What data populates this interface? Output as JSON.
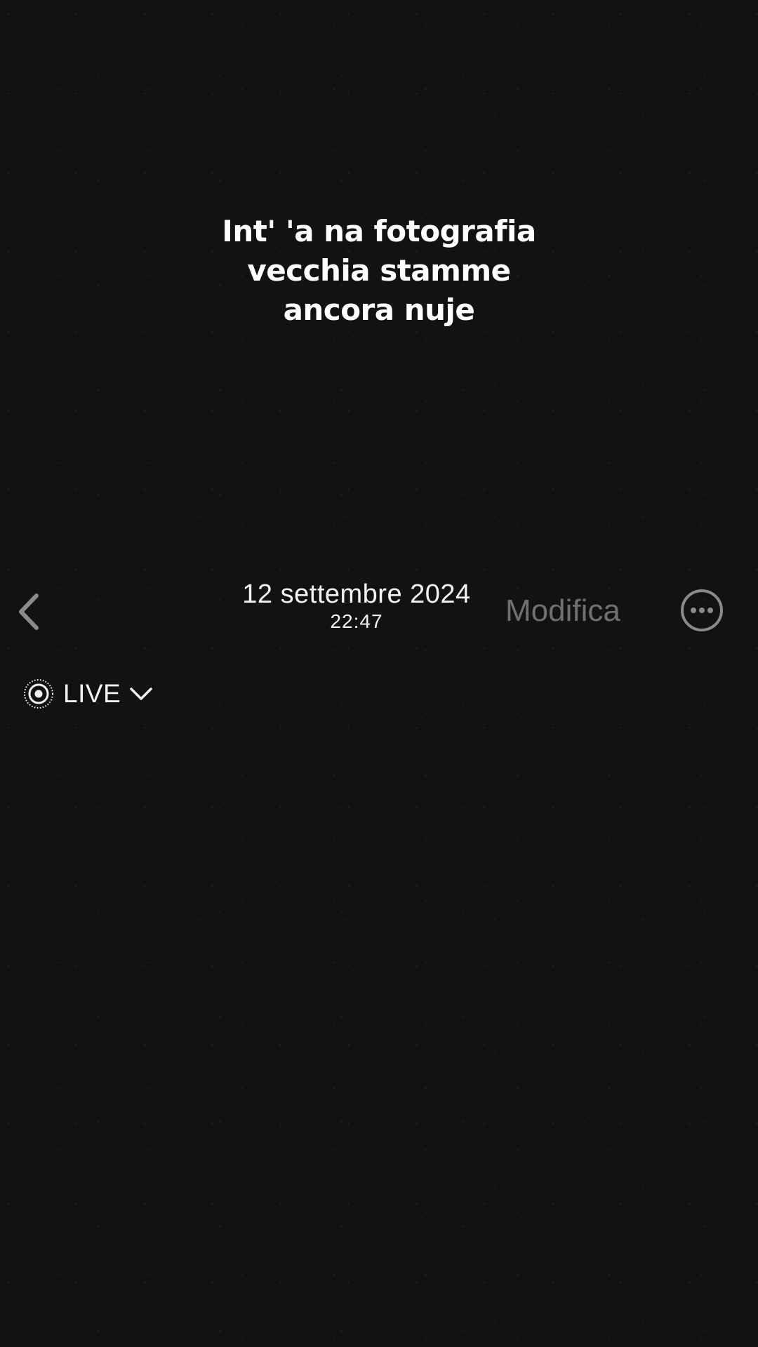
{
  "story": {
    "caption": "Int' 'a na fotografia\nvecchia stamme\nancora nuje"
  },
  "header": {
    "date": "12 settembre 2024",
    "time": "22:47",
    "edit_label": "Modifica",
    "back_icon": "chevron-left-icon",
    "more_icon": "ellipsis-circle-icon"
  },
  "live": {
    "label": "LIVE",
    "icon": "live-photo-icon",
    "dropdown_icon": "chevron-down-icon"
  },
  "colors": {
    "background": "#121212",
    "text": "#ffffff",
    "muted": "#707070"
  }
}
